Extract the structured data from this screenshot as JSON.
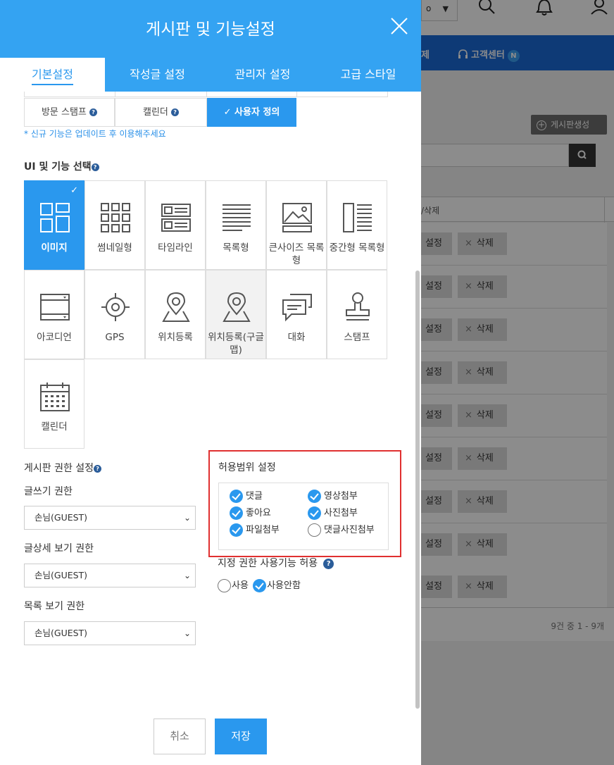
{
  "background": {
    "select_value": "o",
    "nav": {
      "item_partial": "제",
      "support_label": "고객센터",
      "support_badge": "N"
    },
    "create_button": "게시판생성",
    "table_header": "/삭제",
    "row_set_label": "설정",
    "row_delete_label": "삭제",
    "row_delete_icon": "×",
    "footer_count": "9건 중 1 - 9개"
  },
  "modal": {
    "title": "게시판 및 기능설정",
    "tabs": [
      {
        "label": "기본설정",
        "active": true
      },
      {
        "label": "작성글 설정",
        "active": false
      },
      {
        "label": "관리자 설정",
        "active": false
      },
      {
        "label": "고급 스타일",
        "active": false
      }
    ],
    "option_tabs": [
      {
        "label": "방문 스탬프",
        "help": "?"
      },
      {
        "label": "캘린더",
        "help": "?"
      },
      {
        "label": "사용자 정의",
        "check": "✓",
        "selected": true
      }
    ],
    "notice": "* 신규 기능은 업데이트 후 이용해주세요",
    "ui_section": {
      "title": "UI 및 기능 선택",
      "help": "?",
      "selected_mark": "✓",
      "items": [
        {
          "label": "이미지",
          "icon": "image-grid-icon",
          "active": true
        },
        {
          "label": "썸네일형",
          "icon": "thumbnail-grid-icon"
        },
        {
          "label": "타임라인",
          "icon": "timeline-icon"
        },
        {
          "label": "목록형",
          "icon": "list-icon"
        },
        {
          "label": "큰사이즈 목록형",
          "icon": "large-list-icon"
        },
        {
          "label": "중간형 목록형",
          "icon": "medium-list-icon"
        },
        {
          "label": "아코디언",
          "icon": "accordion-icon"
        },
        {
          "label": "GPS",
          "icon": "gps-icon"
        },
        {
          "label": "위치등록",
          "icon": "location-pin-icon"
        },
        {
          "label": "위치등록(구글맵)",
          "icon": "google-map-pin-icon",
          "hover": true
        },
        {
          "label": "대화",
          "icon": "chat-icon"
        },
        {
          "label": "스탬프",
          "icon": "stamp-icon"
        },
        {
          "label": "캘린더",
          "icon": "calendar-icon"
        }
      ]
    },
    "permissions": {
      "title": "게시판 권한 설정",
      "help": "?",
      "fields": [
        {
          "label": "글쓰기 권한",
          "value": "손님(GUEST)"
        },
        {
          "label": "글상세 보기 권한",
          "value": "손님(GUEST)"
        },
        {
          "label": "목록 보기 권한",
          "value": "손님(GUEST)"
        }
      ],
      "dropdown_arrow": "⌄"
    },
    "scope": {
      "title": "허용범위 설정",
      "items": [
        {
          "label": "댓글",
          "checked": true
        },
        {
          "label": "영상첨부",
          "checked": true
        },
        {
          "label": "좋아요",
          "checked": true
        },
        {
          "label": "사진첨부",
          "checked": true
        },
        {
          "label": "파일첨부",
          "checked": true
        },
        {
          "label": "댓글사진첨부",
          "checked": false
        }
      ]
    },
    "assign": {
      "label": "지정 권한 사용기능 허용",
      "help": "?",
      "options": [
        {
          "label": "사용",
          "checked": false
        },
        {
          "label": "사용안함",
          "checked": true
        }
      ]
    },
    "buttons": {
      "cancel": "취소",
      "save": "저장"
    }
  },
  "colors": {
    "primary": "#34a3f2",
    "accent": "#2a98ee",
    "highlight_border": "#e03030",
    "nav_blue": "#1a6ad8"
  }
}
